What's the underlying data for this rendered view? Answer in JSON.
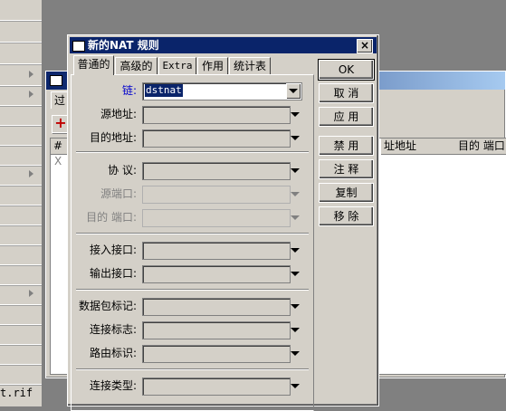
{
  "sidebar": {
    "file_label": "t.rif"
  },
  "background_window": {
    "tab_label": "过",
    "add_icon": "plus-icon",
    "columns": [
      "#",
      "址地址",
      "目的 端口"
    ],
    "row_marker": "X"
  },
  "dialog": {
    "title": "新的NAT 规则",
    "close_label": "×",
    "tabs": [
      "普通的",
      "高级的",
      "Extra",
      "作用",
      "统计表"
    ],
    "active_tab": "普通的",
    "fields": {
      "chain": {
        "label": "链:",
        "value": "dstnat"
      },
      "src_address": {
        "label": "源地址:"
      },
      "dst_address": {
        "label": "目的地址:"
      },
      "protocol": {
        "label": "协 议:"
      },
      "src_port": {
        "label": "源端口:"
      },
      "dst_port": {
        "label": "目的 端口:"
      },
      "in_interface": {
        "label": "接入接口:"
      },
      "out_interface": {
        "label": "输出接口:"
      },
      "packet_mark": {
        "label": "数据包标记:"
      },
      "connection_mark": {
        "label": "连接标志:"
      },
      "routing_mark": {
        "label": "路由标识:"
      },
      "connection_type": {
        "label": "连接类型:"
      }
    },
    "buttons": {
      "ok": "OK",
      "cancel": "取 消",
      "apply": "应 用",
      "disable": "禁 用",
      "comment": "注 释",
      "copy": "复制",
      "remove": "移 除"
    }
  }
}
